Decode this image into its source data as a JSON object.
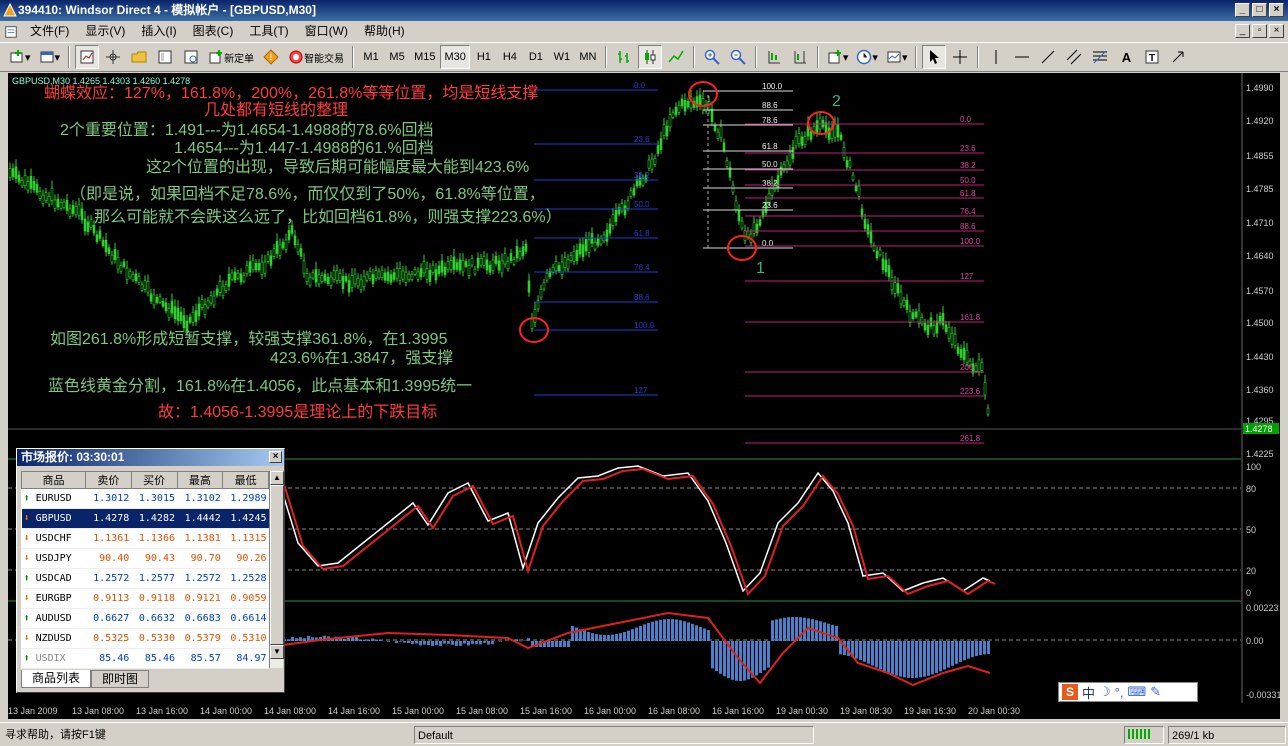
{
  "window": {
    "title": "394410: Windsor Direct 4 - 模拟帐户 - [GBPUSD,M30]"
  },
  "menu": [
    "文件(F)",
    "显示(V)",
    "插入(I)",
    "图表(C)",
    "工具(T)",
    "窗口(W)",
    "帮助(H)"
  ],
  "toolbar": {
    "new_order": "新定单",
    "auto_trade": "智能交易",
    "timeframes": [
      "M1",
      "M5",
      "M15",
      "M30",
      "H1",
      "H4",
      "D1",
      "W1",
      "MN"
    ],
    "active_timeframe": "M30",
    "text_tool": "A"
  },
  "chart": {
    "header": "GBPUSD,M30  1.4265 1.4303 1.4260 1.4278",
    "current_price": "1.4278",
    "price_ticks": [
      "1.4990",
      "1.4920",
      "1.4855",
      "1.4785",
      "1.4710",
      "1.4640",
      "1.4570",
      "1.4500",
      "1.4430",
      "1.4360",
      "1.4295",
      "1.4225"
    ],
    "stoch_ticks": [
      "100",
      "80",
      "50",
      "20",
      "0"
    ],
    "macd_ticks": [
      "0.00223",
      "0.00",
      "-0.00331"
    ],
    "time_ticks": [
      "13 Jan 2009",
      "13 Jan 08:00",
      "13 Jan 16:00",
      "14 Jan 00:00",
      "14 Jan 08:00",
      "14 Jan 16:00",
      "15 Jan 00:00",
      "15 Jan 08:00",
      "15 Jan 16:00",
      "16 Jan 00:00",
      "16 Jan 08:00",
      "16 Jan 16:00",
      "19 Jan 00:30",
      "19 Jan 08:30",
      "19 Jan 16:30",
      "20 Jan 00:30"
    ],
    "fib_blue": [
      "0.0",
      "23.6",
      "38.2",
      "50.0",
      "61.8",
      "76.4",
      "88.6",
      "100.0",
      "127"
    ],
    "fib_white": [
      "100.0",
      "88.6",
      "78.6",
      "61.8",
      "50.0",
      "38.2",
      "23.6",
      "0.0"
    ],
    "fib_magenta": [
      "0.0",
      "23.6",
      "38.2",
      "50.0",
      "61.8",
      "76.4",
      "88.6",
      "100.0",
      "127",
      "161.8",
      "200",
      "223.6",
      "261.8"
    ],
    "wave_labels": [
      "1",
      "2"
    ]
  },
  "annotations": [
    {
      "text": "蝴蝶效应：127%，161.8%，200%，261.8%等等位置，均是短线支撑",
      "color": "#ff3b3b"
    },
    {
      "text": "几处都有短线的整理",
      "color": "#ff3b3b"
    },
    {
      "text": "2个重要位置：1.491---为1.4654-1.4988的78.6%回档",
      "color": "#7ec87e"
    },
    {
      "text": "1.4654---为1.447-1.4988的61.%回档",
      "color": "#7ec87e"
    },
    {
      "text": "这2个位置的出现，导致后期可能幅度最大能到423.6%",
      "color": "#7ec87e"
    },
    {
      "text": "（即是说，如果回档不足78.6%，而仅仅到了50%，61.8%等位置，",
      "color": "#7ec87e"
    },
    {
      "text": "那么可能就不会跌这么远了，比如回档61.8%，则强支撑223.6%）",
      "color": "#7ec87e"
    },
    {
      "text": "如图261.8%形成短暂支撑，较强支撑361.8%，在1.3995",
      "color": "#7ec87e"
    },
    {
      "text": "423.6%在1.3847，强支撑",
      "color": "#7ec87e"
    },
    {
      "text": "蓝色线黄金分割，161.8%在1.4056，此点基本和1.3995统一",
      "color": "#7ec87e"
    },
    {
      "text": "故：1.4056-1.3995是理论上的下跌目标",
      "color": "#ff3b3b"
    }
  ],
  "market_watch": {
    "title": "市场报价: 03:30:01",
    "columns": [
      "商品",
      "卖价",
      "买价",
      "最高",
      "最低"
    ],
    "rows": [
      {
        "symbol": "EURUSD",
        "bid": "1.3012",
        "ask": "1.3015",
        "high": "1.3102",
        "low": "1.2989",
        "dir": "up"
      },
      {
        "symbol": "GBPUSD",
        "bid": "1.4278",
        "ask": "1.4282",
        "high": "1.4442",
        "low": "1.4245",
        "dir": "down"
      },
      {
        "symbol": "USDCHF",
        "bid": "1.1361",
        "ask": "1.1366",
        "high": "1.1381",
        "low": "1.1315",
        "dir": "down"
      },
      {
        "symbol": "USDJPY",
        "bid": "90.40",
        "ask": "90.43",
        "high": "90.70",
        "low": "90.26",
        "dir": "down"
      },
      {
        "symbol": "USDCAD",
        "bid": "1.2572",
        "ask": "1.2577",
        "high": "1.2572",
        "low": "1.2528",
        "dir": "up"
      },
      {
        "symbol": "EURGBP",
        "bid": "0.9113",
        "ask": "0.9118",
        "high": "0.9121",
        "low": "0.9059",
        "dir": "down"
      },
      {
        "symbol": "AUDUSD",
        "bid": "0.6627",
        "ask": "0.6632",
        "high": "0.6683",
        "low": "0.6614",
        "dir": "up"
      },
      {
        "symbol": "NZDUSD",
        "bid": "0.5325",
        "ask": "0.5330",
        "high": "0.5379",
        "low": "0.5310",
        "dir": "down"
      },
      {
        "symbol": "USDIX",
        "bid": "85.46",
        "ask": "85.46",
        "high": "85.57",
        "low": "84.97",
        "dir": "up"
      }
    ],
    "tabs": [
      "商品列表",
      "即时图"
    ]
  },
  "ime": {
    "label": "中"
  },
  "statusbar": {
    "help": "寻求帮助，请按F1键",
    "profile": "Default",
    "traffic": "269/1 kb"
  }
}
